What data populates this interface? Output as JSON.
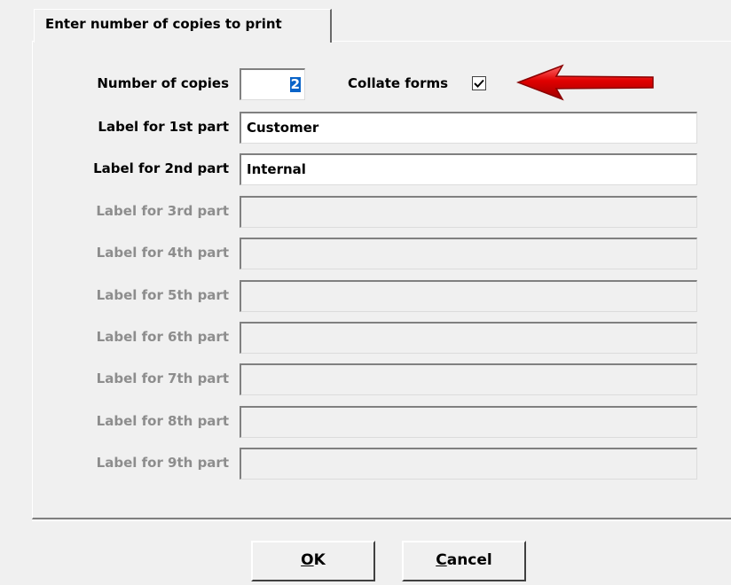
{
  "tab": {
    "label": "Enter number of copies to print"
  },
  "copies": {
    "label": "Number of copies",
    "value": "2"
  },
  "collate": {
    "label": "Collate forms",
    "checked": true
  },
  "parts": [
    {
      "label": "Label for 1st part",
      "value": "Customer",
      "enabled": true
    },
    {
      "label": "Label for 2nd part",
      "value": "Internal",
      "enabled": true
    },
    {
      "label": "Label for 3rd part",
      "value": "",
      "enabled": false
    },
    {
      "label": "Label for 4th part",
      "value": "",
      "enabled": false
    },
    {
      "label": "Label for 5th part",
      "value": "",
      "enabled": false
    },
    {
      "label": "Label for 6th part",
      "value": "",
      "enabled": false
    },
    {
      "label": "Label for 7th part",
      "value": "",
      "enabled": false
    },
    {
      "label": "Label for 8th part",
      "value": "",
      "enabled": false
    },
    {
      "label": "Label for 9th part",
      "value": "",
      "enabled": false
    }
  ],
  "buttons": {
    "ok": {
      "accel": "O",
      "rest": "K"
    },
    "cancel": {
      "accel": "C",
      "rest": "ancel"
    }
  },
  "colors": {
    "window_bg": "#f0f0f0",
    "selection": "#0a64c8",
    "arrow": "#e00000",
    "disabled_text": "#8d8d8d"
  },
  "icons": {
    "arrow": "red-arrow-icon",
    "check": "checkmark-icon"
  }
}
